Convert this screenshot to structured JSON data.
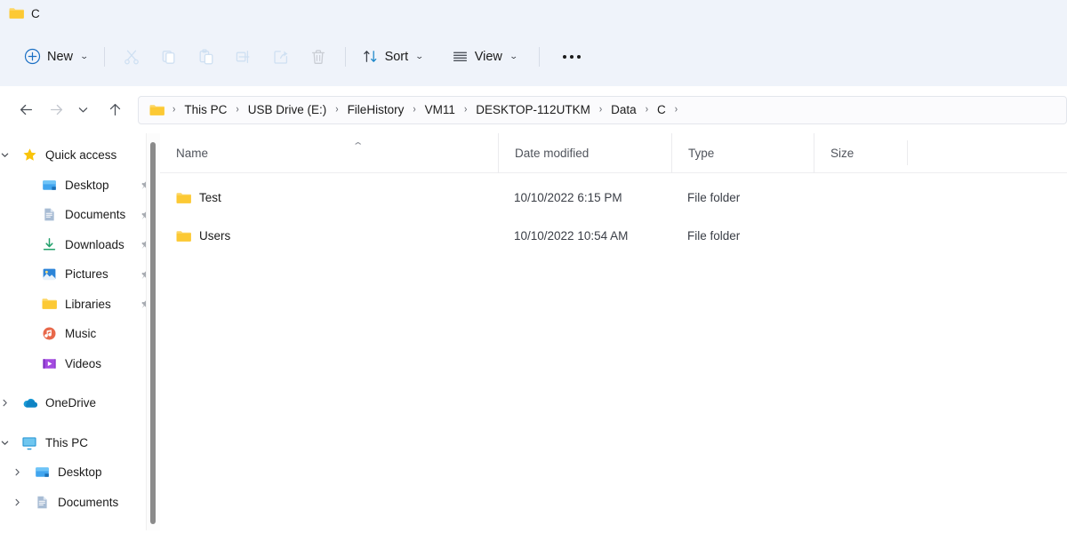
{
  "window": {
    "title": "C",
    "title_icon": "folder-icon"
  },
  "toolbar": {
    "new_label": "New",
    "new_icon": "plus-circle-icon",
    "cut_icon": "scissors-icon",
    "copy_icon": "copy-icon",
    "paste_icon": "clipboard-icon",
    "rename_icon": "rename-icon",
    "share_icon": "share-icon",
    "delete_icon": "trash-icon",
    "sort_label": "Sort",
    "sort_icon": "sort-arrows-icon",
    "view_label": "View",
    "view_icon": "list-lines-icon",
    "more_icon": "ellipsis-icon",
    "chevron": "⌄"
  },
  "address": {
    "back_icon": "arrow-left-icon",
    "forward_icon": "arrow-right-icon",
    "recent_icon": "chevron-down-icon",
    "up_icon": "arrow-up-icon",
    "folder_icon": "folder-icon",
    "separator": "›",
    "crumbs": [
      {
        "label": "This PC"
      },
      {
        "label": "USB Drive (E:)"
      },
      {
        "label": "FileHistory"
      },
      {
        "label": "VM11"
      },
      {
        "label": "DESKTOP-112UTKM"
      },
      {
        "label": "Data"
      },
      {
        "label": "C"
      }
    ]
  },
  "sidebar": {
    "items": [
      {
        "label": "Quick access",
        "icon": "star-icon",
        "twisty": "expanded",
        "indent": 0,
        "pinned": false
      },
      {
        "label": "Desktop",
        "icon": "desktop-icon",
        "twisty": "none",
        "indent": 1,
        "pinned": true
      },
      {
        "label": "Documents",
        "icon": "documents-icon",
        "twisty": "none",
        "indent": 1,
        "pinned": true
      },
      {
        "label": "Downloads",
        "icon": "downloads-icon",
        "twisty": "none",
        "indent": 1,
        "pinned": true
      },
      {
        "label": "Pictures",
        "icon": "pictures-icon",
        "twisty": "none",
        "indent": 1,
        "pinned": true
      },
      {
        "label": "Libraries",
        "icon": "folder-icon",
        "twisty": "none",
        "indent": 1,
        "pinned": true
      },
      {
        "label": "Music",
        "icon": "music-icon",
        "twisty": "none",
        "indent": 1,
        "pinned": false
      },
      {
        "label": "Videos",
        "icon": "videos-icon",
        "twisty": "none",
        "indent": 1,
        "pinned": false
      },
      {
        "label": "OneDrive",
        "icon": "onedrive-icon",
        "twisty": "collapsed",
        "indent": 0,
        "pinned": false
      },
      {
        "label": "This PC",
        "icon": "thispc-icon",
        "twisty": "expanded",
        "indent": 0,
        "pinned": false
      },
      {
        "label": "Desktop",
        "icon": "desktop-icon",
        "twisty": "collapsed",
        "indent": 1,
        "pinned": false
      },
      {
        "label": "Documents",
        "icon": "documents-icon",
        "twisty": "collapsed",
        "indent": 1,
        "pinned": false
      }
    ]
  },
  "filelist": {
    "columns": [
      {
        "label": "Name",
        "sorted": "asc"
      },
      {
        "label": "Date modified",
        "sorted": ""
      },
      {
        "label": "Type",
        "sorted": ""
      },
      {
        "label": "Size",
        "sorted": ""
      }
    ],
    "sort_glyph": "⌃",
    "rows": [
      {
        "name": "Test",
        "icon": "folder-icon",
        "date": "10/10/2022 6:15 PM",
        "type": "File folder",
        "size": ""
      },
      {
        "name": "Users",
        "icon": "folder-icon",
        "date": "10/10/2022 10:54 AM",
        "type": "File folder",
        "size": ""
      }
    ]
  },
  "colors": {
    "chrome": "#eff3fa",
    "folder_yellow": "#fbc02d",
    "accent_blue": "#0f6cbd",
    "disabled": "#cfe0f2"
  }
}
